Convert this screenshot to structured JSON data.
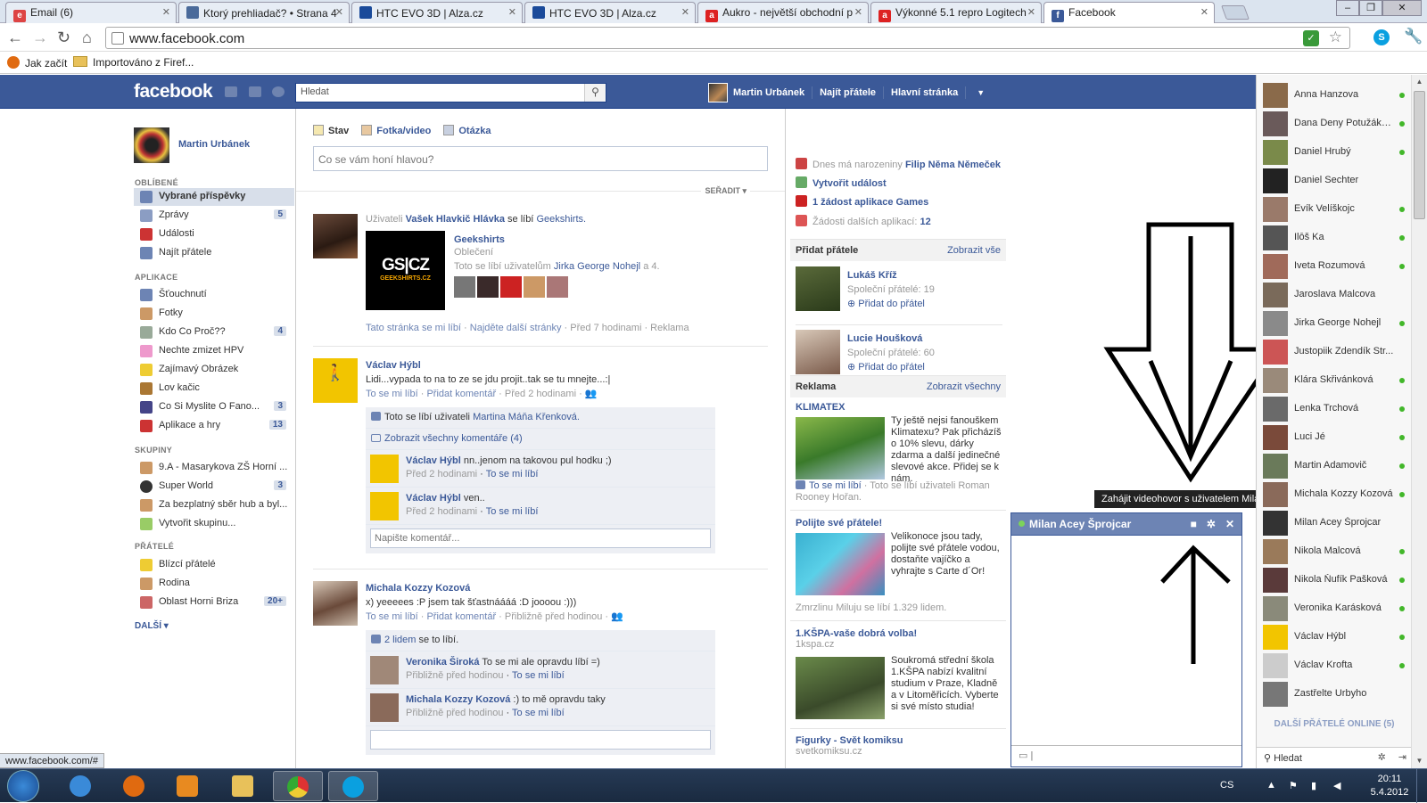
{
  "browser": {
    "tabs": [
      {
        "label": "Email (6)",
        "icon_color": "#d44"
      },
      {
        "label": "Ktorý prehliadač? • Strana 4",
        "icon_color": "#4a6a9a"
      },
      {
        "label": "HTC EVO 3D | Alza.cz",
        "icon_color": "#1a4a9a"
      },
      {
        "label": "HTC EVO 3D | Alza.cz",
        "icon_color": "#1a4a9a"
      },
      {
        "label": "Aukro - největší obchodní p",
        "icon_color": "#d22"
      },
      {
        "label": "Výkonné 5.1 repro Logitech",
        "icon_color": "#d22"
      },
      {
        "label": "Facebook",
        "icon_color": "#3b5998"
      }
    ],
    "url": "www.facebook.com",
    "bookmarks": [
      "Jak začít",
      "Importováno z Firef..."
    ],
    "status_url": "www.facebook.com/#"
  },
  "fb": {
    "logo": "facebook",
    "search_placeholder": "Hledat",
    "user_name": "Martin Urbánek",
    "find_friends": "Najít přátele",
    "home": "Hlavní stránka"
  },
  "left": {
    "profile_name": "Martin Urbánek",
    "fav_head": "OBLÍBENÉ",
    "favorites": [
      {
        "label": "Vybrané příspěvky",
        "count": "",
        "icon_color": "#6d84b4"
      },
      {
        "label": "Zprávy",
        "count": "5",
        "icon_color": "#8b9dc3"
      },
      {
        "label": "Události",
        "count": "",
        "icon_color": "#c33"
      },
      {
        "label": "Najít přátele",
        "count": "",
        "icon_color": "#6d84b4"
      }
    ],
    "apps_head": "APLIKACE",
    "apps": [
      {
        "label": "Šťouchnutí",
        "count": "",
        "icon_color": "#6d84b4"
      },
      {
        "label": "Fotky",
        "count": "",
        "icon_color": "#c96"
      },
      {
        "label": "Kdo Co Proč??",
        "count": "4",
        "icon_color": "#9a9"
      },
      {
        "label": "Nechte zmizet HPV",
        "count": "",
        "icon_color": "#e9c"
      },
      {
        "label": "Zajímavý Obrázek",
        "count": "",
        "icon_color": "#ec3"
      },
      {
        "label": "Lov kačic",
        "count": "",
        "icon_color": "#a73"
      },
      {
        "label": "Co Si Myslite O Fano...",
        "count": "3",
        "icon_color": "#448"
      },
      {
        "label": "Aplikace a hry",
        "count": "13",
        "icon_color": "#c33"
      }
    ],
    "groups_head": "SKUPINY",
    "groups": [
      {
        "label": "9.A - Masarykova ZŠ Horní ...",
        "count": "",
        "icon_color": "#c96"
      },
      {
        "label": "Super World",
        "count": "3",
        "icon_color": "#333"
      },
      {
        "label": "Za bezplatný sběr hub a byl...",
        "count": "",
        "icon_color": "#c96"
      },
      {
        "label": "Vytvořit skupinu...",
        "count": "",
        "icon_color": "#9c6"
      }
    ],
    "friends_head": "PŘÁTELÉ",
    "friend_lists": [
      {
        "label": "Blízcí přátelé",
        "count": "",
        "icon_color": "#ec3"
      },
      {
        "label": "Rodina",
        "count": "",
        "icon_color": "#c96"
      },
      {
        "label": "Oblast Horni Briza",
        "count": "20+",
        "icon_color": "#c66"
      }
    ],
    "more": "DALŠÍ ▾"
  },
  "composer": {
    "tab_status": "Stav",
    "tab_photo": "Fotka/video",
    "tab_question": "Otázka",
    "placeholder": "Co se vám honí hlavou?",
    "sort": "SEŘADIT ▾"
  },
  "stories": {
    "s1": {
      "prefix": "Uživateli",
      "actor": "Vašek Hlavkič Hlávka",
      "verb": "se líbí",
      "object": "Geekshirts.",
      "page_name": "Geekshirts",
      "page_cat": "Oblečení",
      "page_likes_prefix": "Toto se líbí uživatelům",
      "page_likes_user": "Jirka George Nohejl",
      "page_likes_more": "a 4.",
      "logo_text_1": "GS|CZ",
      "logo_text_2": "GEEKSHIRTS.CZ",
      "footer_like": "Tato stránka se mi líbí",
      "footer_find": "Najděte další stránky",
      "footer_time": "Před 7 hodinami",
      "footer_ad": "Reklama"
    },
    "s2": {
      "name": "Václav Hýbl",
      "text": "Lidi...vypada to na to ze se jdu projit..tak se tu mnejte...:|",
      "like": "To se mi líbí",
      "comment": "Přidat komentář",
      "time": "Před 2 hodinami",
      "likes_prefix": "Toto se líbí uživateli",
      "likes_user": "Martina Máňa Křenková.",
      "all_comments": "Zobrazit všechny komentáře (4)",
      "comments": [
        {
          "name": "Václav Hýbl",
          "text": "nn..jenom na takovou pul hodku ;)",
          "time": "Před 2 hodinami",
          "like": "To se mi líbí"
        },
        {
          "name": "Václav Hýbl",
          "text": "ven..",
          "time": "Před 2 hodinami",
          "like": "To se mi líbí"
        }
      ],
      "comment_placeholder": "Napište komentář..."
    },
    "s3": {
      "name": "Michala Kozzy Kozová",
      "text": "x) yeeeees :P jsem tak šťastnáááá :D joooou :)))",
      "like": "To se mi líbí",
      "comment": "Přidat komentář",
      "time": "Přibližně před hodinou",
      "likes_count": "2 lidem",
      "likes_suffix": "se to líbí.",
      "comments": [
        {
          "name": "Veronika Široká",
          "text": "To se mi ale opravdu líbí =)",
          "time": "Přibližně před hodinou",
          "like": "To se mi líbí"
        },
        {
          "name": "Michala Kozzy Kozová",
          "text": ":) to mě opravdu taky",
          "time": "Přibližně před hodinou",
          "like": "To se mi líbí"
        }
      ]
    }
  },
  "right": {
    "bday_prefix": "Dnes má narozeniny",
    "bday_name": "Filip Něma Němeček",
    "create_event": "Vytvořit událost",
    "games_request": "1 žádost aplikace Games",
    "other_requests": "Žádosti dalších aplikací:",
    "other_requests_count": "12",
    "add_friends": "Přidat přátele",
    "show_all": "Zobrazit vše",
    "suggestions": [
      {
        "name": "Lukáš Kříž",
        "mutual": "Společní přátelé: 19",
        "add": "Přidat do přátel"
      },
      {
        "name": "Lucie Houšková",
        "mutual": "Společní přátelé: 60",
        "add": "Přidat do přátel"
      }
    ],
    "ads_head": "Reklama",
    "ads_all": "Zobrazit všechny",
    "ads": [
      {
        "title": "KLIMATEX",
        "text": "Ty ještě nejsi fanouškem Klimatexu? Pak přicházíš o 10% slevu, dárky zdarma a další jedinečné slevové akce. Přidej se k nám.",
        "foot_like": "To se mi líbí",
        "foot_text": "· Toto se líbí uživateli Roman Rooney Hořan."
      },
      {
        "title": "Polijte své přátele!",
        "text": "Velikonoce jsou tady, polijte své přátele vodou, dostaňte vajíčko a vyhrajte s Carte d´Or!",
        "foot_text": "Zmrzlinu Miluju se líbí 1.329 lidem."
      },
      {
        "title": "1.KŠPA-vaše dobrá volba!",
        "subtitle": "1kspa.cz",
        "text": "Soukromá střední škola 1.KŠPA nabízí kvalitní studium v Praze, Kladně a v Litoměřicích. Vyberte si své místo studia!"
      },
      {
        "title": "Figurky - Svět komiksu",
        "subtitle": "svetkomiksu.cz"
      }
    ]
  },
  "chat": {
    "tooltip": "Zahájit videohovor s uživatelem Milan Acey",
    "name": "Milan Acey Šprojcar"
  },
  "friends_list": [
    {
      "name": "Anna Hanzova",
      "online": true,
      "color": "#8a6a4a"
    },
    {
      "name": "Dana Deny Potužáková",
      "online": true,
      "color": "#6a5a5a"
    },
    {
      "name": "Daniel Hrubý",
      "online": true,
      "color": "#7a8a4a"
    },
    {
      "name": "Daniel Sechter",
      "online": false,
      "color": "#222"
    },
    {
      "name": "Evík Velíškojc",
      "online": true,
      "color": "#9a7a6a"
    },
    {
      "name": "Ilōš Ka",
      "online": true,
      "color": "#555"
    },
    {
      "name": "Iveta Rozumová",
      "online": true,
      "color": "#a06a5a"
    },
    {
      "name": "Jaroslava Malcova",
      "online": false,
      "color": "#7a6a5a"
    },
    {
      "name": "Jirka George Nohejl",
      "online": true,
      "color": "#8a8a8a"
    },
    {
      "name": "Justopiik Zdendík Str...",
      "online": false,
      "color": "#c55"
    },
    {
      "name": "Klára Skřivánková",
      "online": true,
      "color": "#9a8a7a"
    },
    {
      "name": "Lenka Trchová",
      "online": true,
      "color": "#6a6a6a"
    },
    {
      "name": "Luci Jé",
      "online": true,
      "color": "#7a4a3a"
    },
    {
      "name": "Martin Adamovič",
      "online": true,
      "color": "#6a7a5a"
    },
    {
      "name": "Michala Kozzy Kozová",
      "online": true,
      "color": "#8a6a5a"
    },
    {
      "name": "Milan Acey Šprojcar",
      "online": false,
      "color": "#333"
    },
    {
      "name": "Nikola Malcová",
      "online": true,
      "color": "#9a7a5a"
    },
    {
      "name": "Nikola Ňufík Pašková",
      "online": true,
      "color": "#5a3a3a"
    },
    {
      "name": "Veronika Karásková",
      "online": true,
      "color": "#8a8a7a"
    },
    {
      "name": "Václav Hýbl",
      "online": true,
      "color": "#f2c500"
    },
    {
      "name": "Václav Krofta",
      "online": true,
      "color": "#ccc"
    },
    {
      "name": "Zastřelte Urbyho",
      "online": false,
      "color": "#777"
    }
  ],
  "friends_more": "DALŠÍ PŘÁTELÉ ONLINE (5)",
  "friends_search": "Hledat",
  "taskbar": {
    "lang": "CS",
    "time": "20:11",
    "date": "5.4.2012"
  }
}
